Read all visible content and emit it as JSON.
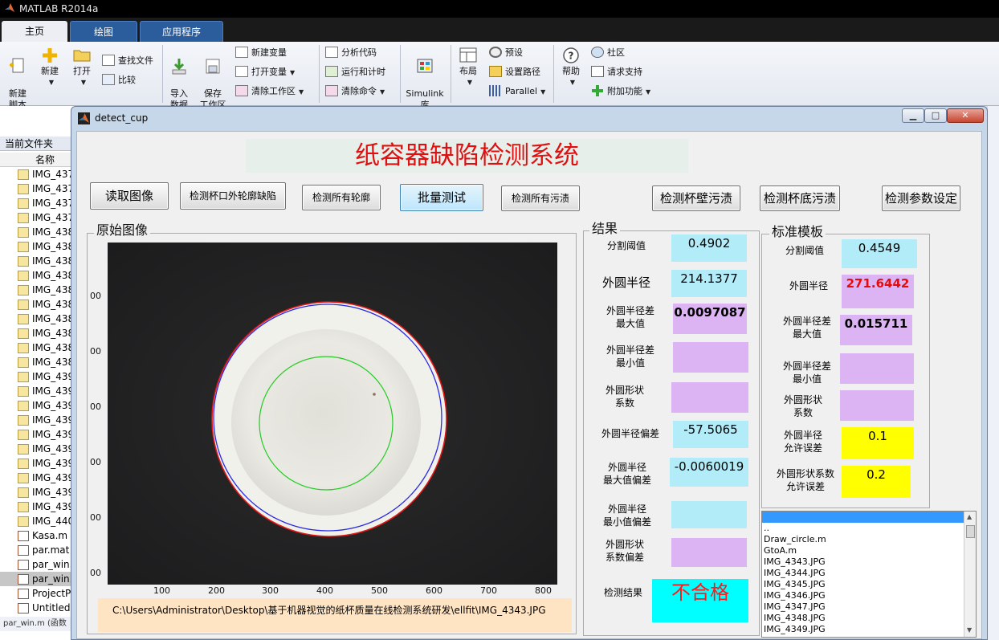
{
  "app": {
    "title": "MATLAB R2014a"
  },
  "ribbon_tabs": [
    {
      "label": "主页",
      "active": true
    },
    {
      "label": "绘图",
      "active": false
    },
    {
      "label": "应用程序",
      "active": false
    }
  ],
  "ribbon": {
    "new_script": "新建\n脚本",
    "new": "新建",
    "open": "打开",
    "find_files": "查找文件",
    "compare": "比较",
    "import_data": "导入\n数据",
    "save_workspace": "保存\n工作区",
    "new_variable": "新建变量",
    "open_variable": "打开变量",
    "clear_workspace": "清除工作区",
    "analyze_code": "分析代码",
    "run_and_time": "运行和计时",
    "clear_commands": "清除命令",
    "simulink": "Simulink\n库",
    "layout": "布局",
    "preferences": "预设",
    "set_path": "设置路径",
    "parallel": "Parallel",
    "help": "帮助",
    "community": "社区",
    "request_support": "请求支持",
    "add_ons": "附加功能"
  },
  "file_panel": {
    "title": "当前文件夹",
    "column_name": "名称",
    "items": [
      {
        "name": "IMG_437",
        "type": "jpg"
      },
      {
        "name": "IMG_437",
        "type": "jpg"
      },
      {
        "name": "IMG_437",
        "type": "jpg"
      },
      {
        "name": "IMG_437",
        "type": "jpg"
      },
      {
        "name": "IMG_438",
        "type": "jpg"
      },
      {
        "name": "IMG_438",
        "type": "jpg"
      },
      {
        "name": "IMG_438",
        "type": "jpg"
      },
      {
        "name": "IMG_438",
        "type": "jpg"
      },
      {
        "name": "IMG_438",
        "type": "jpg"
      },
      {
        "name": "IMG_438",
        "type": "jpg"
      },
      {
        "name": "IMG_438",
        "type": "jpg"
      },
      {
        "name": "IMG_438",
        "type": "jpg"
      },
      {
        "name": "IMG_438",
        "type": "jpg"
      },
      {
        "name": "IMG_438",
        "type": "jpg"
      },
      {
        "name": "IMG_439",
        "type": "jpg"
      },
      {
        "name": "IMG_439",
        "type": "jpg"
      },
      {
        "name": "IMG_439",
        "type": "jpg"
      },
      {
        "name": "IMG_439",
        "type": "jpg"
      },
      {
        "name": "IMG_439",
        "type": "jpg"
      },
      {
        "name": "IMG_439",
        "type": "jpg"
      },
      {
        "name": "IMG_439",
        "type": "jpg"
      },
      {
        "name": "IMG_439",
        "type": "jpg"
      },
      {
        "name": "IMG_439",
        "type": "jpg"
      },
      {
        "name": "IMG_439",
        "type": "jpg"
      },
      {
        "name": "IMG_440",
        "type": "jpg"
      },
      {
        "name": "Kasa.m",
        "type": "m"
      },
      {
        "name": "par.mat",
        "type": "mat"
      },
      {
        "name": "par_win.",
        "type": "fig"
      },
      {
        "name": "par_win.",
        "type": "m",
        "selected": true
      },
      {
        "name": "ProjectP",
        "type": "m"
      },
      {
        "name": "Untitled.",
        "type": "m"
      }
    ],
    "status": "par_win.m (函数"
  },
  "figure": {
    "title": "detect_cup",
    "system_title": "纸容器缺陷检测系统",
    "buttons": {
      "read_image": "读取图像",
      "detect_rim_defect": "检测杯口外轮廓缺陷",
      "detect_all_contours": "检测所有轮廓",
      "batch_test": "批量测试",
      "detect_all_stains": "检测所有污渍",
      "detect_wall_stain": "检测杯壁污渍",
      "detect_bottom_stain": "检测杯底污渍",
      "param_settings": "检测参数设定"
    },
    "original_image": {
      "title": "原始图像",
      "y_ticks": [
        "00",
        "00",
        "00",
        "00",
        "00",
        "00"
      ],
      "x_ticks": [
        "100",
        "200",
        "300",
        "400",
        "500",
        "600",
        "700",
        "800"
      ]
    },
    "result": {
      "title": "结果",
      "threshold_label": "分割阈值",
      "threshold": "0.4902",
      "outer_radius_label": "外圆半径",
      "outer_radius": "214.1377",
      "radius_diff_max_label": "外圆半径差\n最大值",
      "radius_diff_max": "0.0097087",
      "radius_diff_min_label": "外圆半径差\n最小值",
      "radius_diff_min": "",
      "shape_coef_label": "外圆形状\n系数",
      "shape_coef": "",
      "radius_dev_label": "外圆半径偏差",
      "radius_dev": "-57.5065",
      "radius_max_dev_label": "外圆半径\n最大值偏差",
      "radius_max_dev": "-0.0060019",
      "radius_min_dev_label": "外圆半径\n最小值偏差",
      "radius_min_dev": "",
      "shape_coef_dev_label": "外圆形状\n系数偏差",
      "shape_coef_dev": "",
      "verdict_label": "检测结果",
      "verdict": "不合格"
    },
    "template": {
      "title": "标准模板",
      "threshold_label": "分割阈值",
      "threshold": "0.4549",
      "outer_radius_label": "外圆半径",
      "outer_radius": "271.6442",
      "radius_diff_max_label": "外圆半径差\n最大值",
      "radius_diff_max": "0.015711",
      "radius_diff_min_label": "外圆半径差\n最小值",
      "radius_diff_min": "",
      "shape_coef_label": "外圆形状\n系数",
      "shape_coef": "",
      "radius_tol_label": "外圆半径\n允许误差",
      "radius_tol": "0.1",
      "shape_coef_tol_label": "外圆形状系数\n允许误差",
      "shape_coef_tol": "0.2"
    },
    "file_list": [
      "..",
      "Draw_circle.m",
      "GtoA.m",
      "IMG_4343.JPG",
      "IMG_4344.JPG",
      "IMG_4345.JPG",
      "IMG_4346.JPG",
      "IMG_4347.JPG",
      "IMG_4348.JPG",
      "IMG_4349.JPG"
    ],
    "image_path": "C:\\Users\\Administrator\\Desktop\\基于机器视觉的纸杯质量在线检测系统研发\\ellfit\\IMG_4343.JPG"
  },
  "colors": {
    "title_red": "#e01010",
    "value_cyan": "#b3ecf9",
    "value_violet": "#dcb4f4",
    "value_yellow": "#ffff00",
    "verdict_bg": "#00ffff"
  }
}
